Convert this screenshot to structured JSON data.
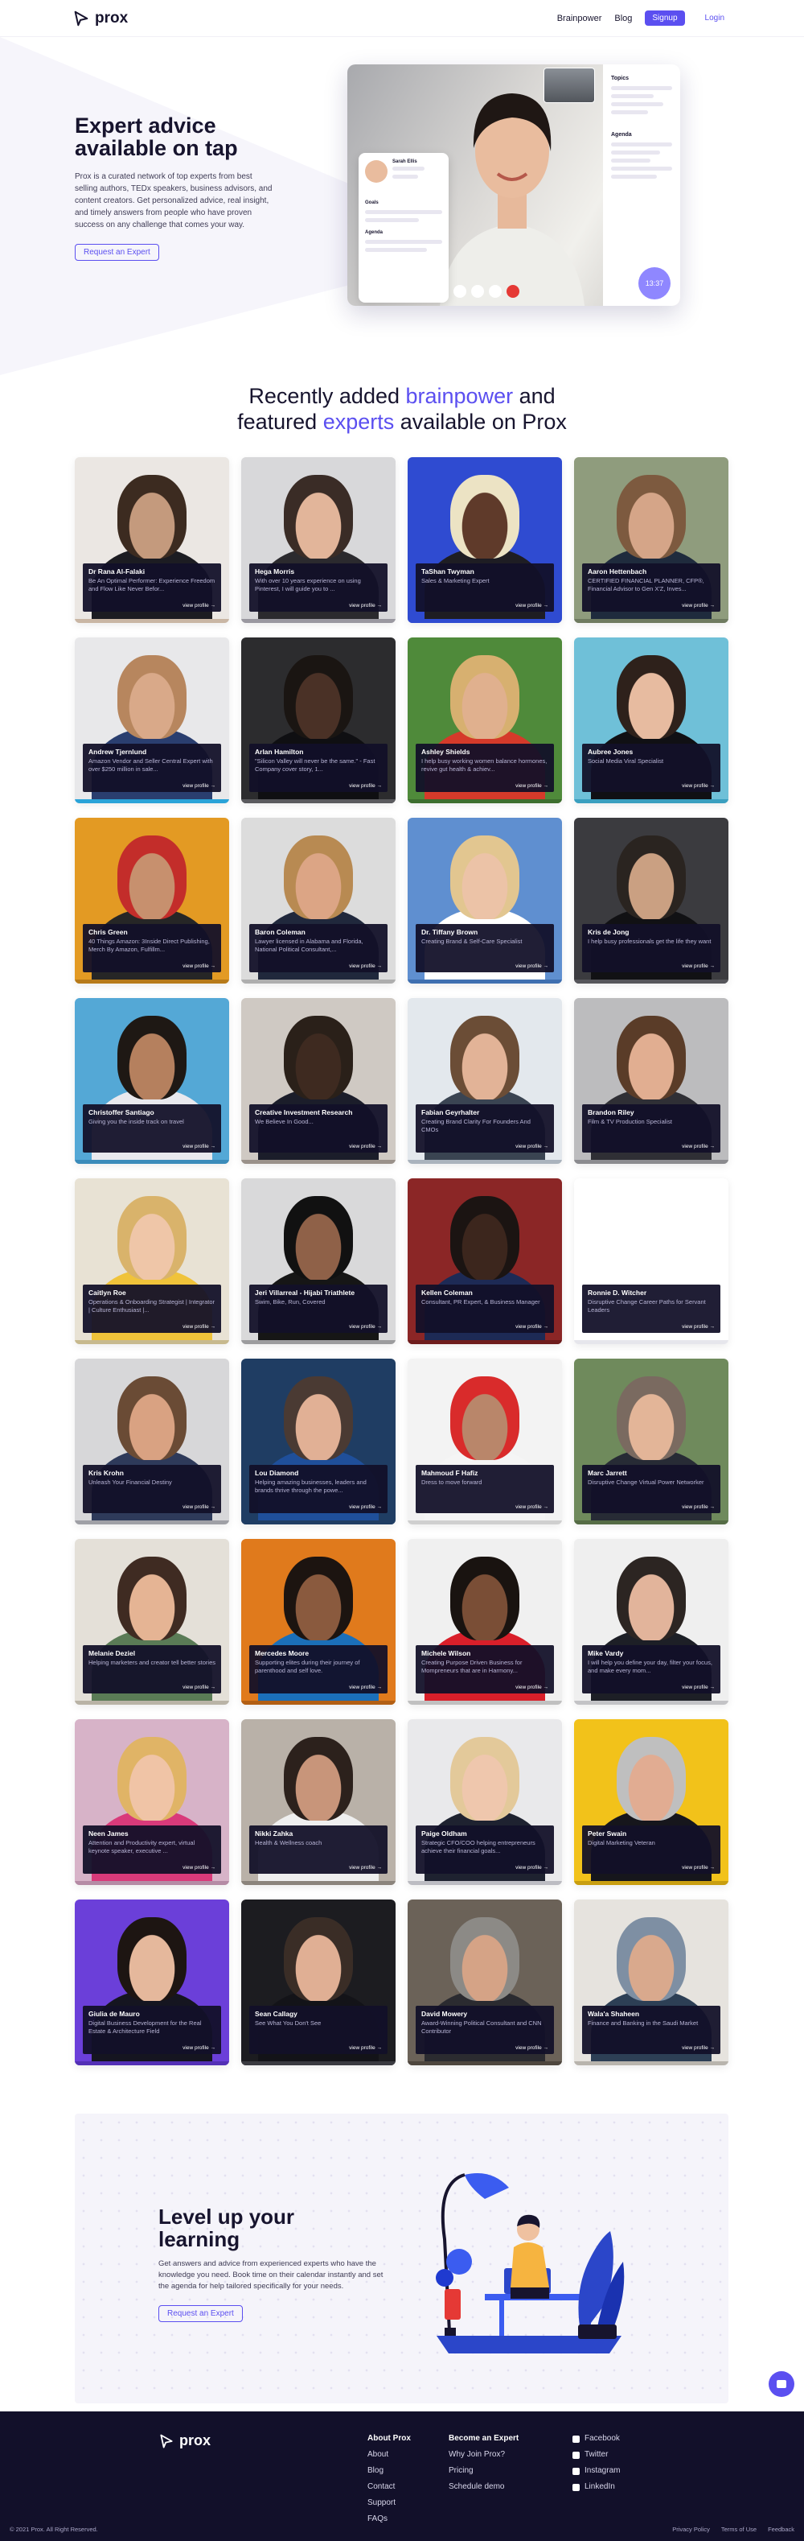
{
  "nav": {
    "brand": "prox",
    "links": [
      "Brainpower",
      "Blog"
    ],
    "signup": "Signup",
    "login": "Login"
  },
  "hero": {
    "title": "Expert advice available on tap",
    "body": "Prox is a curated network of top experts from best selling authors, TEDx speakers, business advisors, and content creators. Get personalized advice, real insight, and timely answers from people who have proven success on any challenge that comes your way.",
    "cta": "Request an Expert",
    "video": {
      "host_name": "Sarah Ellis",
      "section_topics": "Topics",
      "section_agenda": "Agenda",
      "section_goals": "Goals",
      "timer": "13:37"
    }
  },
  "section": {
    "title_a": "Recently added ",
    "title_hl1": "brainpower",
    "title_b": " and",
    "title_c": "featured ",
    "title_hl2": "experts",
    "title_d": " available on Prox"
  },
  "view_label": "view profile →",
  "experts": [
    {
      "name": "Dr Rana Al-Falaki",
      "desc": "Be An Optimal Performer: Experience Freedom and Flow Like Never Befor...",
      "bg": "#ebe7e3",
      "skin": "#c49a7d",
      "hair": "#3c2b20",
      "shirt": "#1c1c22",
      "bar": "#c9b6a4"
    },
    {
      "name": "Hega Morris",
      "desc": "With over 10 years experience on using Pinterest, I will guide you to ...",
      "bg": "#d8d8da",
      "skin": "#e2b59a",
      "hair": "#3a2c26",
      "shirt": "#2b2a2e",
      "bar": "#9a98a0"
    },
    {
      "name": "TaShan Twyman",
      "desc": "Sales & Marketing Expert",
      "bg": "#2f4bd1",
      "skin": "#5f3a2a",
      "hair": "#ece3c4",
      "shirt": "#1e1d23",
      "bar": "#2f4bd1"
    },
    {
      "name": "Aaron Hettenbach",
      "desc": "CERTIFIED FINANCIAL PLANNER, CFP®, Financial Advisor to Gen X'Z, Inves...",
      "bg": "#8f9c7d",
      "skin": "#d5a588",
      "hair": "#7d5a3f",
      "shirt": "#1f2b3d",
      "bar": "#6f7b60"
    },
    {
      "name": "Andrew Tjernlund",
      "desc": "Amazon Vendor and Seller Central Expert with over $250 million in sale...",
      "bg": "#e8e8ea",
      "skin": "#d9a989",
      "hair": "#b7865e",
      "shirt": "#2a3e6f",
      "bar": "#2aa3d8"
    },
    {
      "name": "Arlan Hamilton",
      "desc": "\"Silicon Valley will never be the same.\" - Fast Company cover story, 1...",
      "bg": "#2c2c2e",
      "skin": "#4a3126",
      "hair": "#1a1512",
      "shirt": "#0f0f12",
      "bar": "#5a5a5e"
    },
    {
      "name": "Ashley Shields",
      "desc": "I help busy working women balance hormones, revive gut health & achiev...",
      "bg": "#4f8a3a",
      "skin": "#e0b08e",
      "hair": "#d7b070",
      "shirt": "#d53a2a",
      "bar": "#3d6e2e"
    },
    {
      "name": "Aubree Jones",
      "desc": "Social Media Viral Specialist",
      "bg": "#6fc0d8",
      "skin": "#e7bba0",
      "hair": "#2e211b",
      "shirt": "#101014",
      "bar": "#3a9fbf"
    },
    {
      "name": "Chris Green",
      "desc": "40 Things Amazon: 3Inside Direct Publishing, Merch By Amazon, Fulfillm...",
      "bg": "#e39a23",
      "skin": "#c7906e",
      "hair": "#c32d2a",
      "shirt": "#262626",
      "bar": "#b77a19"
    },
    {
      "name": "Baron Coleman",
      "desc": "Lawyer licensed in Alabama and Florida, National Political Consultant,...",
      "bg": "#dcdcdc",
      "skin": "#dca585",
      "hair": "#b88a52",
      "shirt": "#20283c",
      "bar": "#aeaeae"
    },
    {
      "name": "Dr. Tiffany Brown",
      "desc": "Creating Brand & Self-Care Specialist",
      "bg": "#5f8fd0",
      "skin": "#ecc3a7",
      "hair": "#e2c690",
      "shirt": "#ffffff",
      "bar": "#3f6fb0"
    },
    {
      "name": "Kris de Jong",
      "desc": "I help busy professionals get the life they want",
      "bg": "#3b3b3f",
      "skin": "#caa082",
      "hair": "#2a2420",
      "shirt": "#111114",
      "bar": "#55555a"
    },
    {
      "name": "Christoffer Santiago",
      "desc": "Giving you the inside track on travel",
      "bg": "#54a8d6",
      "skin": "#b5805e",
      "hair": "#1e1814",
      "shirt": "#e9e9ee",
      "bar": "#3a8bba"
    },
    {
      "name": "Creative Investment Research",
      "desc": "We Believe In Good...",
      "bg": "#cfc9c3",
      "skin": "#3e2a20",
      "hair": "#2a2019",
      "shirt": "#1b1d2a",
      "bar": "#9a918a"
    },
    {
      "name": "Fabian Geyrhalter",
      "desc": "Creating Brand Clarity For Founders And CMOs",
      "bg": "#e3e8ed",
      "skin": "#e2b397",
      "hair": "#6b4d36",
      "shirt": "#3a4452",
      "bar": "#aab3bd"
    },
    {
      "name": "Brandon Riley",
      "desc": "Film & TV Production Specialist",
      "bg": "#bcbcbe",
      "skin": "#e1ae91",
      "hair": "#5a3c28",
      "shirt": "#2f2f35",
      "bar": "#8b8b8f"
    },
    {
      "name": "Caitlyn Roe",
      "desc": "Operations & Onboarding Strategist | Integrator | Culture Enthusiast |...",
      "bg": "#e8e2d4",
      "skin": "#efc6a8",
      "hair": "#d9b36b",
      "shirt": "#f0c33a",
      "bar": "#c7b98e"
    },
    {
      "name": "Jeri Villarreal - Hijabi Triathlete",
      "desc": "Swim, Bike, Run, Covered",
      "bg": "#d9d9da",
      "skin": "#8f6148",
      "hair": "#111111",
      "shirt": "#161616",
      "bar": "#9c9c9e"
    },
    {
      "name": "Kellen Coleman",
      "desc": "Consultant, PR Expert, & Business Manager",
      "bg": "#8b2626",
      "skin": "#3c261d",
      "hair": "#1b1412",
      "shirt": "#1d2a55",
      "bar": "#6e1c1c"
    },
    {
      "name": "Ronnie D. Witcher",
      "desc": "Disruptive Change Career Paths for Servant Leaders",
      "bg": "#ffffff",
      "skin": "#ffffff",
      "hair": "#ffffff",
      "shirt": "#ffffff",
      "bar": "#e6e6ec"
    },
    {
      "name": "Kris Krohn",
      "desc": "Unleash Your Financial Destiny",
      "bg": "#d7d7d9",
      "skin": "#d9a282",
      "hair": "#6a4b35",
      "shirt": "#2e3a5a",
      "bar": "#9fa0a6"
    },
    {
      "name": "Lou Diamond",
      "desc": "Helping amazing businesses, leaders and brands thrive through the powe...",
      "bg": "#1f3d63",
      "skin": "#e1b095",
      "hair": "#4a3a33",
      "shirt": "#1f4f9a",
      "bar": "#1f3d63"
    },
    {
      "name": "Mahmoud F Hafiz",
      "desc": "Dress to move forward",
      "bg": "#f3f3f3",
      "skin": "#b9866a",
      "hair": "#d92b2b",
      "shirt": "#f5f5f5",
      "bar": "#cfcfcf"
    },
    {
      "name": "Marc Jarrett",
      "desc": "Disruptive Change Virtual Power Networker",
      "bg": "#6f8a5c",
      "skin": "#e3b598",
      "hair": "#7a6a60",
      "shirt": "#272b35",
      "bar": "#556c45"
    },
    {
      "name": "Melanie Deziel",
      "desc": "Helping marketers and creator tell better stories",
      "bg": "#e4e0d8",
      "skin": "#e5b494",
      "hair": "#3f2b22",
      "shirt": "#5a7b56",
      "bar": "#b9b3a6"
    },
    {
      "name": "Mercedes Moore",
      "desc": "Supporting elites during their journey of parenthood and self love.",
      "bg": "#e07a1c",
      "skin": "#8a5a3e",
      "hair": "#1c1410",
      "shirt": "#1b6fb9",
      "bar": "#b25f14"
    },
    {
      "name": "Michele Wilson",
      "desc": "Creating Purpose Driven Business for Mompreneurs that are in Harmony...",
      "bg": "#f0f0f0",
      "skin": "#7a4e36",
      "hair": "#191310",
      "shirt": "#d91f2a",
      "bar": "#c0c0c0"
    },
    {
      "name": "Mike Vardy",
      "desc": "I will help you define your day, filter your focus, and make every mom...",
      "bg": "#efefef",
      "skin": "#e2b49b",
      "hair": "#2c2522",
      "shirt": "#1d1f26",
      "bar": "#c3c3c6"
    },
    {
      "name": "Neen James",
      "desc": "Attention and Productivity expert, virtual keynote speaker, executive ...",
      "bg": "#d7b3c8",
      "skin": "#f0c4a6",
      "hair": "#e0b466",
      "shirt": "#d93a7a",
      "bar": "#b58ba5"
    },
    {
      "name": "Nikki Zahka",
      "desc": "Health & Wellness coach",
      "bg": "#b9b1a8",
      "skin": "#c8957a",
      "hair": "#2c211c",
      "shirt": "#efefef",
      "bar": "#8b847c"
    },
    {
      "name": "Paige Oldham",
      "desc": "Strategic CFO/COO helping entrepreneurs achieve their financial goals...",
      "bg": "#e9e9eb",
      "skin": "#efc7ad",
      "hair": "#e3c99a",
      "shirt": "#1e2230",
      "bar": "#bcbcc2"
    },
    {
      "name": "Peter Swain",
      "desc": "Digital Marketing Veteran",
      "bg": "#f2c21a",
      "skin": "#e1ac92",
      "hair": "#bfbfbf",
      "shirt": "#16161c",
      "bar": "#c89e10"
    },
    {
      "name": "Giulia de Mauro",
      "desc": "Digital Business Development for the Real Estate & Architecture Field",
      "bg": "#6b3fd9",
      "skin": "#e5b89c",
      "hair": "#1d1512",
      "shirt": "#151520",
      "bar": "#5330b5"
    },
    {
      "name": "Sean Callagy",
      "desc": "See What You Don't See",
      "bg": "#1c1c20",
      "skin": "#e0af94",
      "hair": "#3a2d26",
      "shirt": "#131318",
      "bar": "#3a3a40"
    },
    {
      "name": "David Mowery",
      "desc": "Award-Winning Political Consultant and CNN Contributor",
      "bg": "#6b6258",
      "skin": "#d5a386",
      "hair": "#8c8a86",
      "shirt": "#2b2b30",
      "bar": "#4e463e"
    },
    {
      "name": "Wala'a Shaheen",
      "desc": "Finance and Banking in the Saudi Market",
      "bg": "#e6e3de",
      "skin": "#d9a98d",
      "hair": "#7e8fa3",
      "shirt": "#2d3f55",
      "bar": "#b8b4ad"
    }
  ],
  "learning": {
    "title": "Level up your learning",
    "body": "Get answers and advice from experienced experts who have the knowledge you need. Book time on their calendar instantly and set the agenda for help tailored specifically for your needs.",
    "cta": "Request an Expert"
  },
  "footer": {
    "brand": "prox",
    "col1": {
      "heading": "About Prox",
      "items": [
        "About",
        "Blog",
        "Contact",
        "Support",
        "FAQs"
      ]
    },
    "col2": {
      "heading": "Become an Expert",
      "items": [
        "Why Join Prox?",
        "Pricing",
        "Schedule demo"
      ]
    },
    "col3": {
      "items": [
        "Facebook",
        "Twitter",
        "Instagram",
        "LinkedIn"
      ]
    },
    "copyright": "© 2021 Prox. All Right Reserved.",
    "legal": [
      "Privacy Policy",
      "Terms of Use",
      "Feedback"
    ]
  },
  "colors": {
    "accent": "#5b4ff0",
    "footer_bg": "#12102a"
  }
}
